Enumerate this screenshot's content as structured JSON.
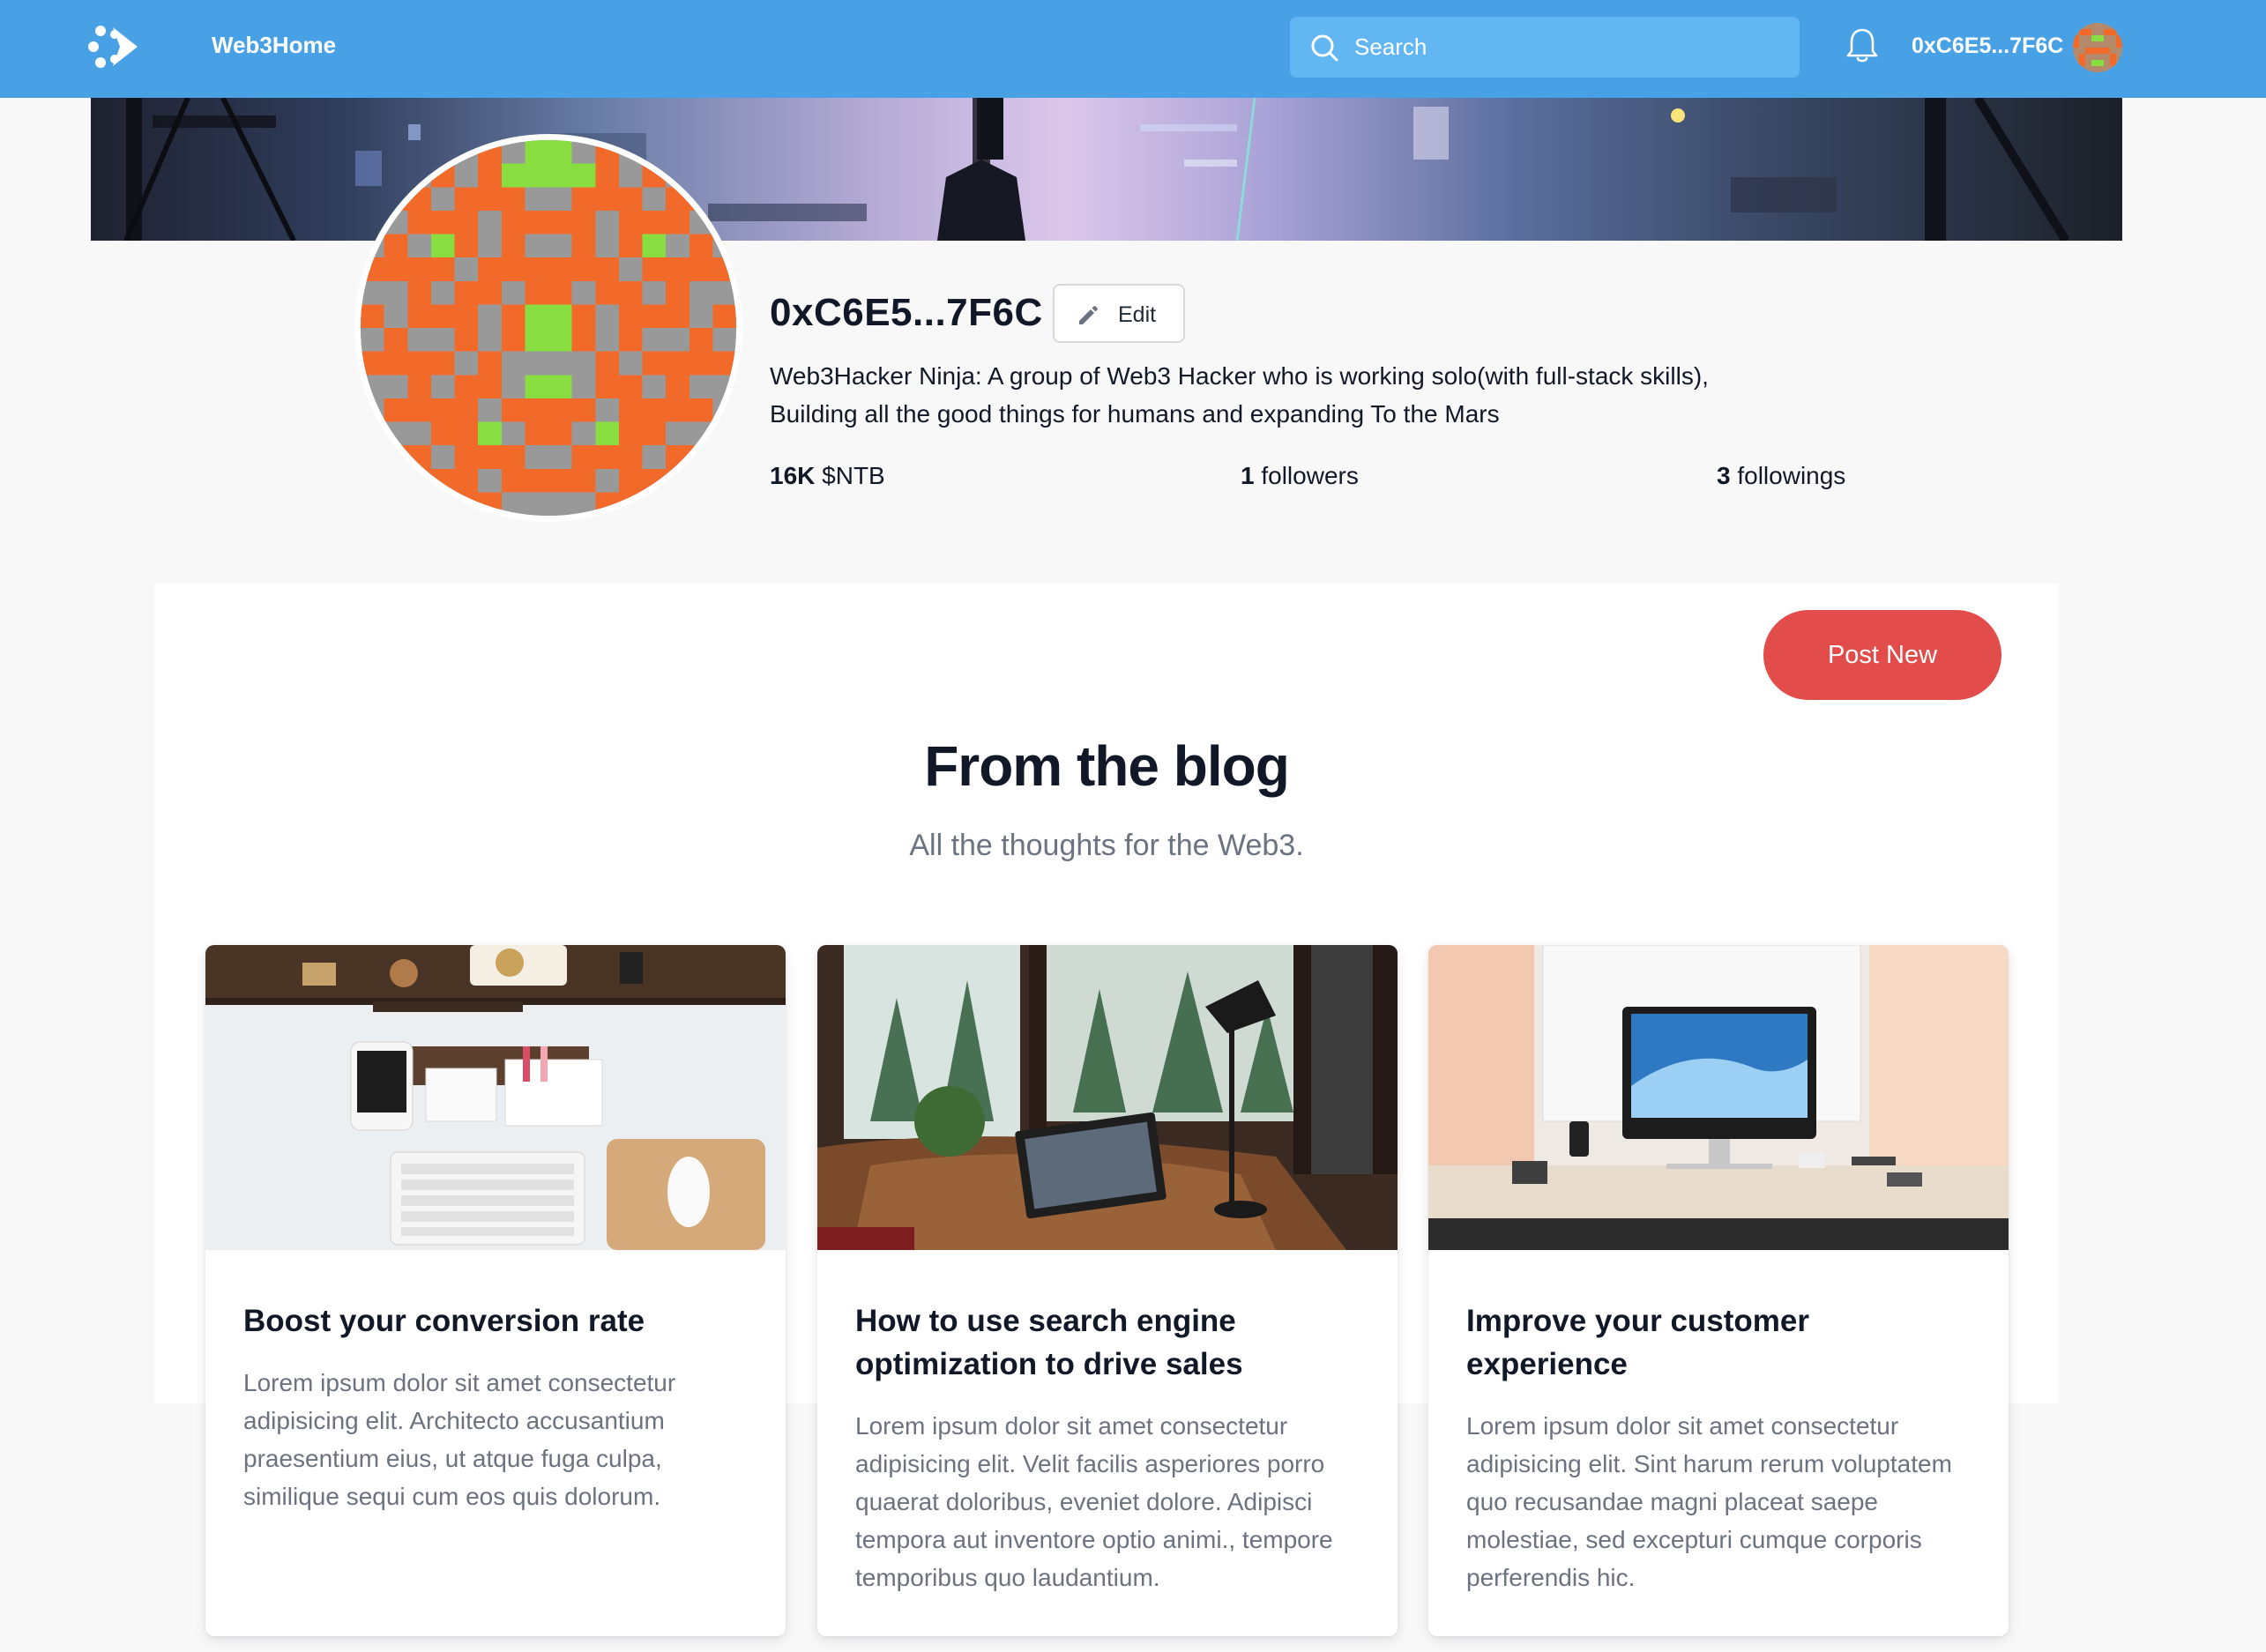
{
  "navbar": {
    "brand": "Web3Home",
    "logo_icon": "web3home-logo-icon",
    "search": {
      "placeholder": "Search",
      "value": "",
      "icon": "search-icon"
    },
    "notification_icon": "bell-icon",
    "address": "0xC6E5...7F6C",
    "avatar_icon": "identicon-avatar",
    "colors": {
      "bar": "#48a1e4",
      "search_bg": "#62b6f1"
    }
  },
  "profile": {
    "name": "0xC6E5...7F6C",
    "edit_label": "Edit",
    "bio_lines": [
      "Web3Hacker Ninja: A group of Web3 Hacker who is working solo(with full-stack skills),",
      "Building all the good things for humans and expanding To the Mars"
    ],
    "stats": {
      "balance_value": "16K",
      "balance_unit": "$NTB",
      "followers_value": "1",
      "followers_label": "followers",
      "followings_value": "3",
      "followings_label": "followings"
    },
    "identicon_colors": {
      "bg": "#999999",
      "primary": "#f26a2a",
      "accent": "#88de40"
    }
  },
  "blog": {
    "post_new_label": "Post New",
    "title": "From the blog",
    "subtitle": "All the thoughts for the Web3.",
    "accent": "#e24c4b",
    "posts": [
      {
        "title": "Boost your conversion rate",
        "excerpt": "Lorem ipsum dolor sit amet consectetur adipisicing elit. Architecto accusantium praesentium eius, ut atque fuga culpa, similique sequi cum eos quis dolorum.",
        "image": "desk-workspace-image"
      },
      {
        "title": "How to use search engine optimization to drive sales",
        "excerpt": "Lorem ipsum dolor sit amet consectetur adipisicing elit. Velit facilis asperiores porro quaerat doloribus, eveniet dolore. Adipisci tempora aut inventore optio animi., tempore temporibus quo laudantium.",
        "image": "laptop-window-image"
      },
      {
        "title": "Improve your customer experience",
        "excerpt": "Lorem ipsum dolor sit amet consectetur adipisicing elit. Sint harum rerum voluptatem quo recusandae magni placeat saepe molestiae, sed excepturi cumque corporis perferendis hic.",
        "image": "imac-desk-image"
      }
    ]
  }
}
